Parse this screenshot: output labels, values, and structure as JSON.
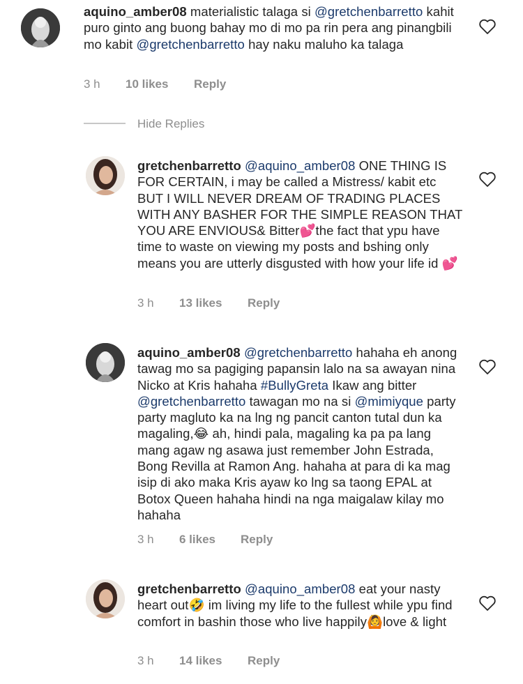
{
  "comments": [
    {
      "username": "aquino_amber08",
      "segments": [
        {
          "t": " materialistic talaga si "
        },
        {
          "m": "@gretchenbarretto"
        },
        {
          "t": " kahit puro ginto ang buong bahay mo di mo pa rin pera ang pinangbili mo kabit "
        },
        {
          "m": "@gretchenbarretto"
        },
        {
          "t": " hay naku maluho ka talaga"
        }
      ],
      "time": "3 h",
      "likes": "10 likes",
      "reply": "Reply"
    },
    {
      "username": "gretchenbarretto",
      "segments": [
        {
          "t": " "
        },
        {
          "m": "@aquino_amber08"
        },
        {
          "t": " ONE THING IS FOR CERTAIN, i may be called a Mistress/ kabit etc BUT I WILL NEVER DREAM OF TRADING PLACES WITH ANY BASHER FOR THE SIMPLE REASON THAT YOU ARE ENVIOUS& Bitter💕the fact that ypu have time to waste on viewing my posts and bshing only means you are utterly disgusted with how your life id 💕"
        }
      ],
      "time": "3 h",
      "likes": "13 likes",
      "reply": "Reply"
    },
    {
      "username": "aquino_amber08",
      "segments": [
        {
          "t": " "
        },
        {
          "m": "@gretchenbarretto"
        },
        {
          "t": " hahaha eh anong tawag mo sa pagiging papansin lalo na sa awayan nina Nicko at Kris hahaha "
        },
        {
          "m": "#BullyGreta"
        },
        {
          "t": " Ikaw ang bitter "
        },
        {
          "m": "@gretchenbarretto"
        },
        {
          "t": " tawagan mo na si "
        },
        {
          "m": "@mimiyque"
        },
        {
          "t": " party party magluto ka na lng ng pancit canton tutal dun ka magaling,😂 ah, hindi pala, magaling ka pa pa lang mang agaw ng asawa just remember John Estrada, Bong Revilla at Ramon Ang. hahaha at para di ka mag isip di ako maka Kris ayaw ko lng sa taong EPAL at Botox Queen hahaha hindi na nga maigalaw  kilay mo hahaha"
        }
      ],
      "time": "3 h",
      "likes": "6 likes",
      "reply": "Reply"
    },
    {
      "username": "gretchenbarretto",
      "segments": [
        {
          "t": " "
        },
        {
          "m": "@aquino_amber08"
        },
        {
          "t": " eat your nasty heart out🤣 im living my life to the fullest while ypu find comfort in bashin those who live happily🙆love & light"
        }
      ],
      "time": "3 h",
      "likes": "14 likes",
      "reply": "Reply"
    }
  ],
  "hide_replies": "Hide Replies",
  "icons": {
    "like": "heart-outline-icon"
  },
  "colors": {
    "text": "#262626",
    "muted": "#8e8e8e",
    "mention": "#1b3a6b"
  }
}
